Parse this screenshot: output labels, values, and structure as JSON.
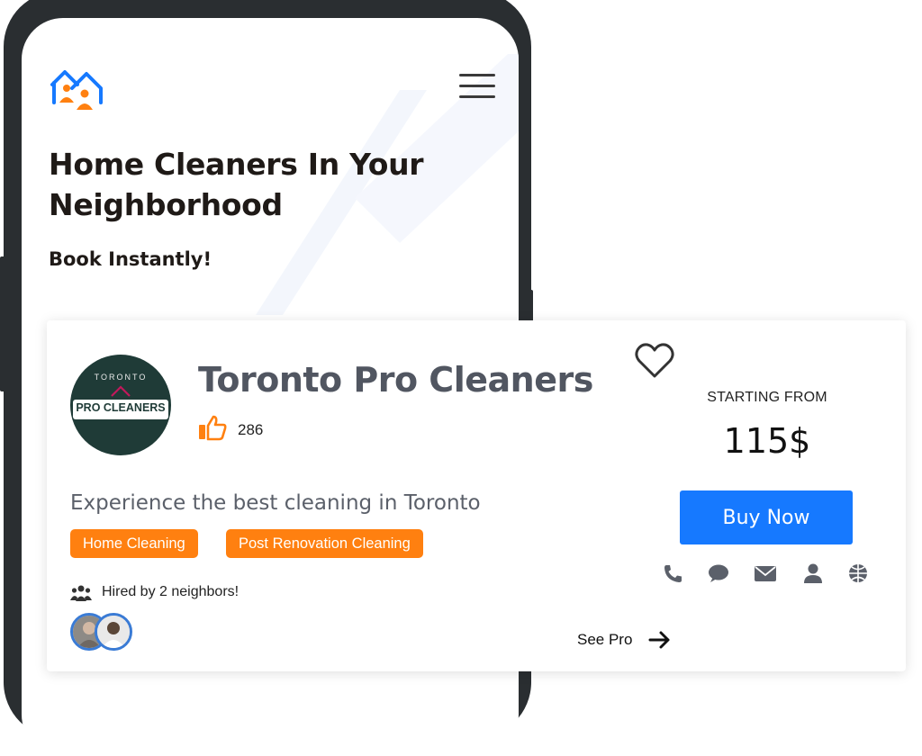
{
  "header": {
    "logo_icon": "house-people-logo-icon",
    "menu_icon": "hamburger-menu-icon"
  },
  "hero": {
    "title": "Home Cleaners In Your Neighborhood",
    "subtitle": "Book Instantly!"
  },
  "listing": {
    "logo": {
      "top_text": "TORONTO",
      "main_text": "PRO CLEANERS"
    },
    "name": "Toronto Pro Cleaners",
    "likes": "286",
    "tagline": "Experience the best cleaning in Toronto",
    "tags": [
      "Home Cleaning",
      "Post Renovation Cleaning"
    ],
    "hired_text": "Hired by 2 neighbors!",
    "see_pro_label": "See Pro",
    "starting_label": "STARTING FROM",
    "price": "115$",
    "buy_label": "Buy Now",
    "contact_icons": [
      "phone-icon",
      "chat-icon",
      "email-icon",
      "user-icon",
      "globe-icon"
    ]
  },
  "colors": {
    "accent_orange": "#ff8010",
    "brand_blue": "#1679ff",
    "title_gray": "#515661",
    "logo_green": "#1f3b37"
  }
}
